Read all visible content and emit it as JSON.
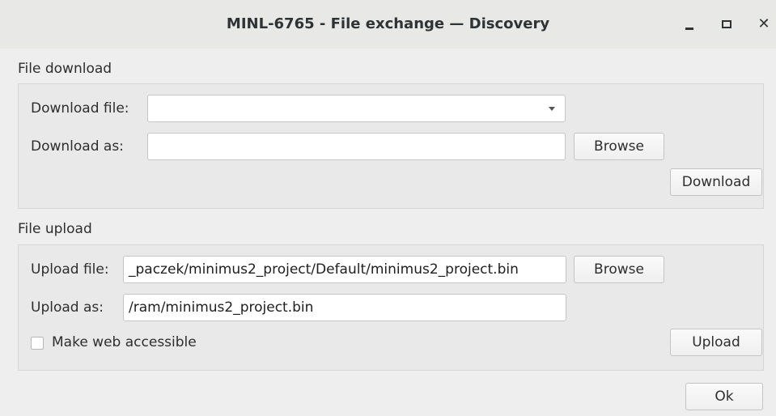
{
  "window": {
    "title": "MINL-6765 - File exchange — Discovery",
    "controls": {
      "minimize_icon": "minimize-icon",
      "maximize_icon": "maximize-icon",
      "close_icon": "close-icon"
    }
  },
  "download": {
    "section_label": "File download",
    "file_label": "Download file:",
    "file_value": "",
    "as_label": "Download as:",
    "as_value": "",
    "browse_label": "Browse",
    "action_label": "Download"
  },
  "upload": {
    "section_label": "File upload",
    "file_label": "Upload file:",
    "file_value": "_paczek/minimus2_project/Default/minimus2_project.bin",
    "as_label": "Upload as:",
    "as_value": "/ram/minimus2_project.bin",
    "browse_label": "Browse",
    "web_accessible_label": "Make web accessible",
    "web_accessible_checked": false,
    "action_label": "Upload"
  },
  "footer": {
    "ok_label": "Ok"
  }
}
